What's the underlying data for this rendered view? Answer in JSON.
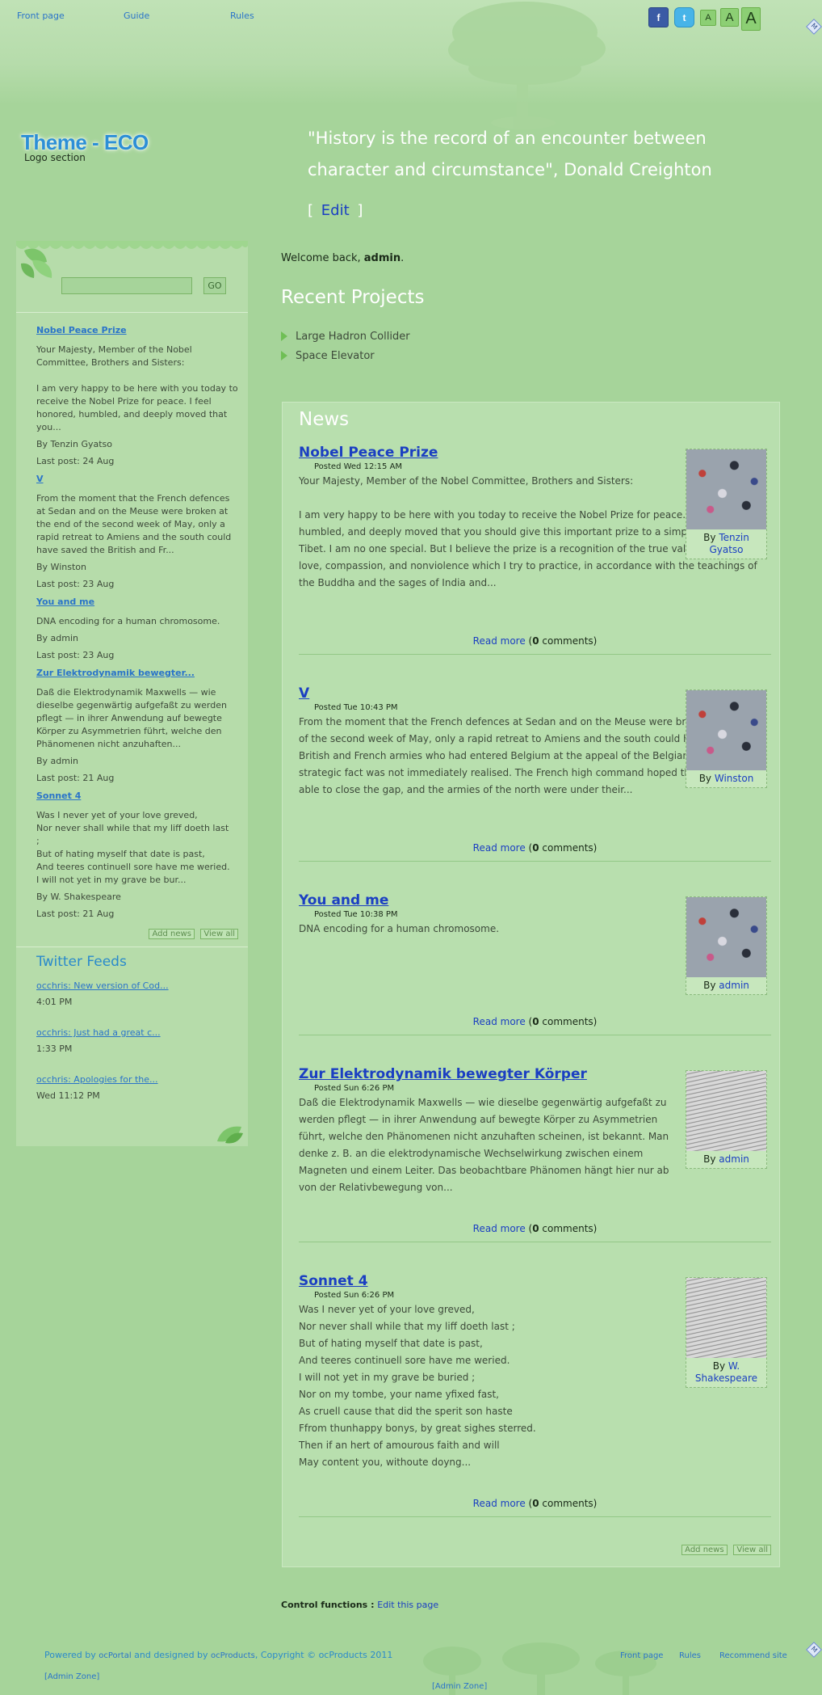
{
  "topnav": [
    "Front page",
    "Guide",
    "Rules"
  ],
  "social": {
    "facebook": "f",
    "twitter": "t"
  },
  "font_sizes": [
    "A",
    "A",
    "A"
  ],
  "corner_icon": "M",
  "logo": {
    "title": "Theme - ECO",
    "subtitle": "Logo section"
  },
  "quote": "\"History is the record of an encounter between character and circumstance\", Donald Creighton",
  "edit": {
    "open": "[",
    "label": "Edit",
    "close": "]"
  },
  "search": {
    "button": "GO",
    "value": ""
  },
  "sidebar_news": [
    {
      "title": "Nobel Peace Prize",
      "excerpt": "Your Majesty, Member of the Nobel Committee, Brothers and Sisters:\n\nI am very happy to be here with you today to receive the Nobel Prize for peace. I feel honored, humbled, and deeply moved that you...",
      "by": "By Tenzin Gyatso",
      "last": "Last post: 24 Aug"
    },
    {
      "title": "V",
      "excerpt": "From the moment that the French defences at Sedan and on the Meuse were broken at the end of the second week of May, only a rapid retreat to Amiens and the south could have saved the British and Fr...",
      "by": "By Winston",
      "last": "Last post: 23 Aug"
    },
    {
      "title": "You and me",
      "excerpt": "DNA encoding for a human chromosome.",
      "by": "By admin",
      "last": "Last post: 23 Aug"
    },
    {
      "title": "Zur Elektrodynamik bewegter...",
      "excerpt": "Daß die Elektrodynamik Maxwells — wie dieselbe gegenwärtig aufgefaßt zu werden pflegt — in ihrer Anwendung auf bewegte Körper zu Asymmetrien führt, welche den Phänomenen nicht anzuhaften...",
      "by": "By admin",
      "last": "Last post: 21 Aug"
    },
    {
      "title": "Sonnet 4",
      "excerpt": "Was I never yet of your love greved,\nNor never shall while that my liff doeth last\n;\nBut of hating myself that date is past,\nAnd teeres continuell sore have me weried.\nI will not yet in my grave be bur...",
      "by": "By W. Shakespeare",
      "last": "Last post: 21 Aug"
    }
  ],
  "sidebar_buttons": {
    "add": "Add news",
    "view": "View all"
  },
  "twitter": {
    "title": "Twitter Feeds",
    "items": [
      {
        "text": "occhris: New version of Cod...",
        "time": "4:01 PM"
      },
      {
        "text": "occhris: Just had a great c...",
        "time": "1:33 PM"
      },
      {
        "text": "occhris: Apologies for the...",
        "time": "Wed 11:12 PM"
      }
    ]
  },
  "welcome": {
    "prefix": "Welcome back, ",
    "user": "admin",
    "suffix": "."
  },
  "recent_projects": {
    "title": "Recent Projects",
    "items": [
      "Large Hadron Collider",
      "Space Elevator"
    ]
  },
  "news": {
    "title": "News",
    "articles": [
      {
        "title": "Nobel Peace Prize",
        "posted": "Posted Wed 12:15 AM",
        "body": "Your Majesty, Member of the Nobel Committee, Brothers and Sisters:\n\nI am very happy to be here with you today to receive the Nobel Prize for peace. I feel honored, humbled, and deeply moved that you should give this important prize to a simple monk from Tibet. I am no one special. But I believe the prize is a recognition of the true value of altruism, love, compassion, and nonviolence which I try to practice, in accordance with the teachings of the Buddha and the sages of India and...",
        "by_prefix": "By",
        "author": "Tenzin Gyatso",
        "image": "crowd"
      },
      {
        "title": "V",
        "posted": "Posted Tue 10:43 PM",
        "body": "From the moment that the French defences at Sedan and on the Meuse were broken at the end of the second week of May, only a rapid retreat to Amiens and the south could have saved the British and French armies who had entered Belgium at the appeal of the Belgian king; but this strategic fact was not immediately realised. The French high command hoped they would be able to close the gap, and the armies of the north were under their...",
        "by_prefix": "By",
        "author": "Winston",
        "image": "crowd"
      },
      {
        "title": "You and me",
        "posted": "Posted Tue 10:38 PM",
        "body": "DNA encoding for a human chromosome.",
        "by_prefix": "By",
        "author": "admin",
        "image": "crowd"
      },
      {
        "title": "Zur Elektrodynamik bewegter Körper",
        "posted": "Posted Sun 6:26 PM",
        "body": "Daß die Elektrodynamik Maxwells — wie dieselbe gegenwärtig aufgefaßt zu werden pflegt — in ihrer Anwendung auf bewegte Körper zu Asymmetrien führt, welche den Phänomenen nicht anzuhaften scheinen, ist bekannt. Man denke z. B. an die elektrodynamische Wechselwirkung zwischen einem Magneten und einem Leiter. Das beobachtbare Phänomen hängt hier nur ab von der Relativbewegung von...",
        "by_prefix": "By",
        "author": "admin",
        "image": "newspaper"
      },
      {
        "title": "Sonnet 4",
        "posted": "Posted Sun 6:26 PM",
        "body": "Was I never yet of your love greved,\nNor never shall while that my liff doeth last ;\nBut of hating myself that date is past,\nAnd teeres continuell sore have me weried.\nI will not yet in my grave be buried ;\nNor on my tombe, your name yfixed fast,\nAs cruell cause that did the sperit son haste\nFfrom thunhappy bonys, by great sighes sterred.\nThen if an hert of amourous faith and will\nMay content you, withoute doyng...",
        "by_prefix": "By",
        "author": "W. Shakespeare",
        "image": "newspaper"
      }
    ],
    "read_more": "Read more",
    "comments_open": " (",
    "comments_count": "0",
    "comments_close": " comments)",
    "add": "Add news",
    "view": "View all"
  },
  "control": {
    "label": "Control functions : ",
    "link": "Edit this page"
  },
  "footer": {
    "powered_prefix": "Powered by ",
    "ocportal": "ocPortal",
    "and_designed": " and designed by ",
    "ocproducts": "ocProducts",
    "copyright": ", Copyright © ocProducts 2011",
    "links": [
      "Front page",
      "Rules",
      "Recommend site"
    ],
    "admin_zone": "[Admin Zone]"
  },
  "colors": {
    "background": "#a6d49a",
    "panel": "#b8dfae",
    "link": "#1b3fc2",
    "accent": "#2a8acb"
  }
}
